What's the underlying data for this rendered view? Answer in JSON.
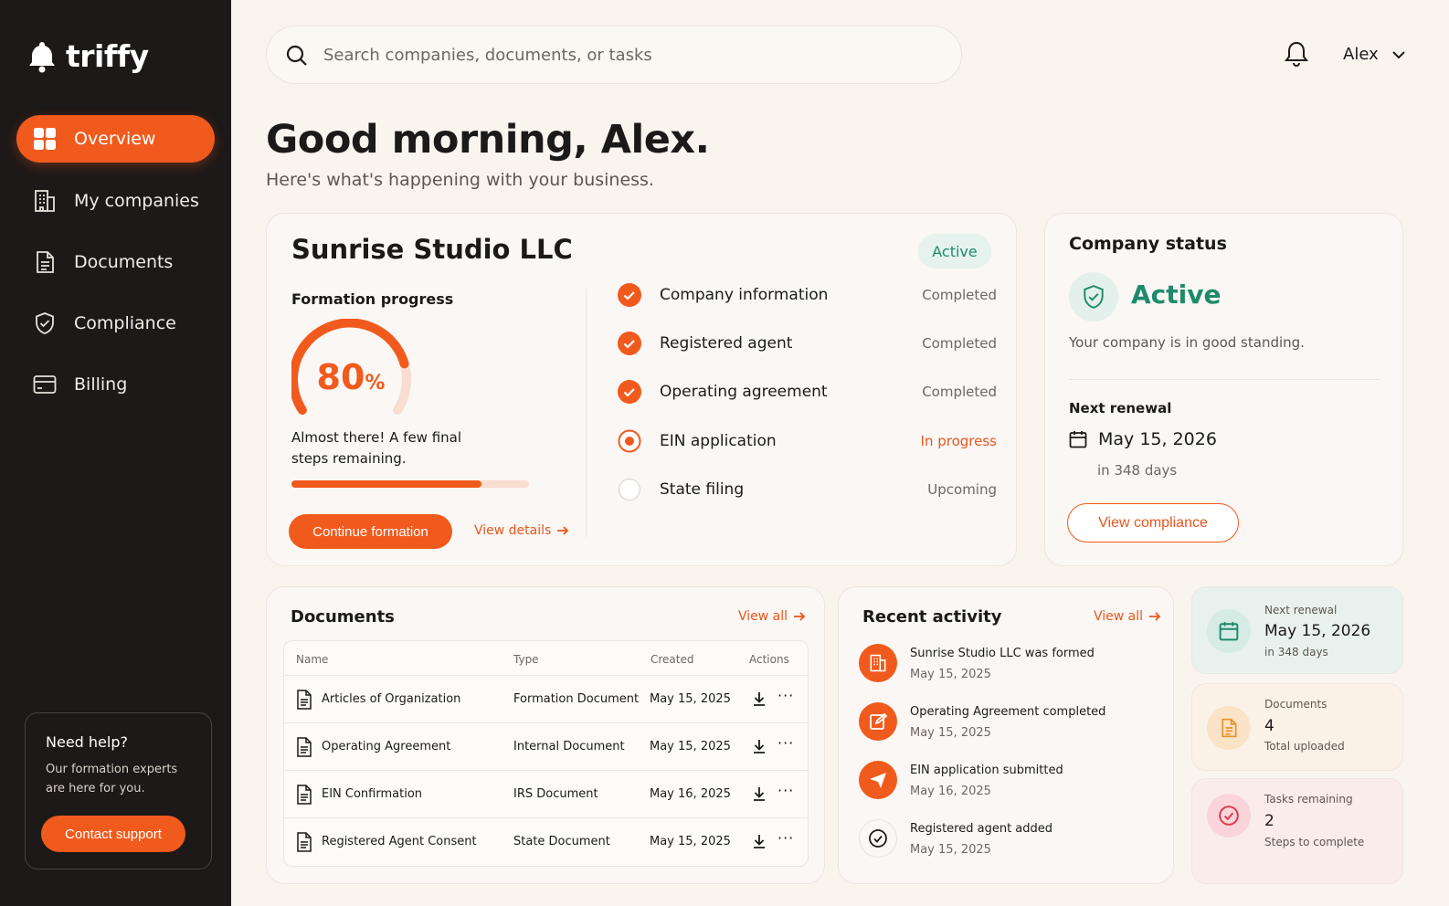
{
  "brand": {
    "name": "triffy",
    "accent": "#f15a1d"
  },
  "sidebar": {
    "items": [
      {
        "label": "Overview",
        "icon": "grid-icon"
      },
      {
        "label": "My companies",
        "icon": "building-icon"
      },
      {
        "label": "Documents",
        "icon": "document-icon"
      },
      {
        "label": "Compliance",
        "icon": "shield-check-icon"
      },
      {
        "label": "Billing",
        "icon": "card-icon"
      }
    ],
    "help": {
      "title": "Need help?",
      "text": "Our formation experts are here for you.",
      "button": "Contact support"
    }
  },
  "header": {
    "search_placeholder": "Search companies, documents, or tasks",
    "user": "Alex"
  },
  "greeting": {
    "title": "Good morning, Alex.",
    "subtitle": "Here's what's happening with your business."
  },
  "company": {
    "name": "Sunrise Studio LLC",
    "status": "Active",
    "formation_label": "Formation progress",
    "progress_value": "80",
    "progress_unit": "%",
    "progress_fraction": 0.8,
    "progress_text": "Almost there! A few final steps remaining.",
    "continue_button": "Continue formation",
    "details_link": "View details",
    "steps": [
      {
        "label": "Company information",
        "status": "Completed",
        "state": "done"
      },
      {
        "label": "Registered agent",
        "status": "Completed",
        "state": "done"
      },
      {
        "label": "Operating agreement",
        "status": "Completed",
        "state": "done"
      },
      {
        "label": "EIN application",
        "status": "In progress",
        "state": "progress"
      },
      {
        "label": "State filing",
        "status": "Upcoming",
        "state": "upcoming"
      }
    ]
  },
  "company_status": {
    "title": "Company status",
    "status": "Active",
    "note": "Your company is in good standing.",
    "renewal_label": "Next renewal",
    "renewal_date": "May 15, 2026",
    "renewal_days": "in 348 days",
    "button": "View compliance"
  },
  "documents": {
    "title": "Documents",
    "view_all": "View all",
    "columns": [
      "Name",
      "Type",
      "Created",
      "Actions"
    ],
    "rows": [
      {
        "name": "Articles of Organization",
        "type": "Formation Document",
        "created": "May 15, 2025"
      },
      {
        "name": "Operating Agreement",
        "type": "Internal Document",
        "created": "May 15, 2025"
      },
      {
        "name": "EIN Confirmation",
        "type": "IRS Document",
        "created": "May 16, 2025"
      },
      {
        "name": "Registered Agent Consent",
        "type": "State Document",
        "created": "May 15, 2025"
      }
    ],
    "more": "···"
  },
  "activity": {
    "title": "Recent activity",
    "view_all": "View all",
    "items": [
      {
        "text": "Sunrise Studio LLC was formed",
        "date": "May 15, 2025",
        "icon": "building-icon"
      },
      {
        "text": "Operating Agreement completed",
        "date": "May 15, 2025",
        "icon": "edit-icon"
      },
      {
        "text": "EIN application submitted",
        "date": "May 16, 2025",
        "icon": "send-icon"
      },
      {
        "text": "Registered agent added",
        "date": "May 15, 2025",
        "icon": "check-circle-icon"
      }
    ]
  },
  "stats": [
    {
      "label": "Next renewal",
      "value": "May 15, 2026",
      "sub": "in 348 days",
      "color": "#1d8b6b"
    },
    {
      "label": "Documents",
      "value": "4",
      "sub": "Total uploaded",
      "color": "#e8912a"
    },
    {
      "label": "Tasks remaining",
      "value": "2",
      "sub": "Steps to complete",
      "color": "#e2354f"
    }
  ]
}
